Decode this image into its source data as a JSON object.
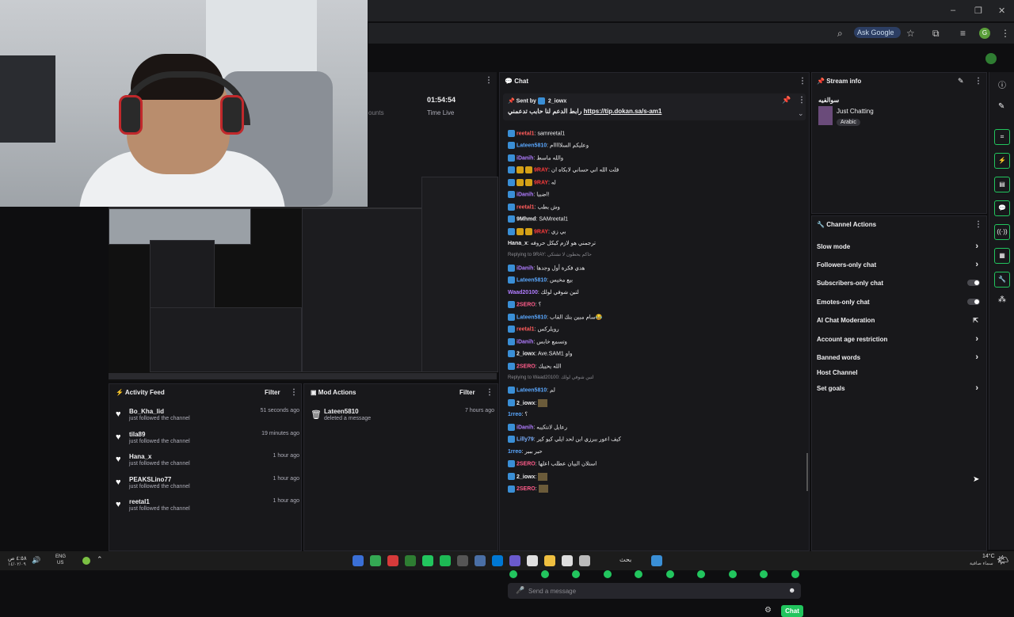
{
  "browser": {
    "ask_google": "Ask Google",
    "window_controls": [
      "–",
      "❐",
      "✕"
    ],
    "avatar_letter": "G"
  },
  "preview": {
    "time_value": "01:54:54",
    "time_label": "Time Live",
    "faded_label": "ounts"
  },
  "activity_feed": {
    "title": "Activity Feed",
    "filter": "Filter",
    "items": [
      {
        "name": "Bo_Kha_lid",
        "sub": "just followed the channel",
        "time": "51 seconds ago"
      },
      {
        "name": "tila89",
        "sub": "just followed the channel",
        "time": "19 minutes ago"
      },
      {
        "name": "Hana_x",
        "sub": "just followed the channel",
        "time": "1 hour ago"
      },
      {
        "name": "PEAKSLino77",
        "sub": "just followed the channel",
        "time": "1 hour ago"
      },
      {
        "name": "reetal1",
        "sub": "just followed the channel",
        "time": "1 hour ago"
      }
    ]
  },
  "mod_actions": {
    "title": "Mod Actions",
    "filter": "Filter",
    "items": [
      {
        "name": "Lateen5810",
        "sub": "deleted a message",
        "time": "7 hours ago"
      }
    ]
  },
  "chat": {
    "title": "Chat",
    "pinned_sender_prefix": "Sent by",
    "pinned_sender": "2_iowx",
    "pinned_text": "رابط الدعم لنا حابب تدعمني",
    "pinned_link": "https://tip.dokan.sa/s-am1",
    "messages": [
      {
        "user": "reetal1",
        "color": "#ff5c5c",
        "text": "samreetal1",
        "badges": 1
      },
      {
        "user": "Lateen5810",
        "color": "#5aa8ff",
        "text": "وعليكم السلااااام",
        "badges": 1
      },
      {
        "user": "iDanih",
        "color": "#b07cff",
        "text": "والله ماسط",
        "badges": 1
      },
      {
        "user": "9RAY",
        "color": "#ff3c3c",
        "text": "قلت الله اني حساني لابكاه ان",
        "badges": 3
      },
      {
        "user": "9RAY",
        "color": "#ff3c3c",
        "text": "له",
        "badges": 3
      },
      {
        "user": "iDanih",
        "color": "#b07cff",
        "text": "اضبيا!",
        "badges": 1
      },
      {
        "user": "reetal1",
        "color": "#ff5c5c",
        "text": "وش بطب",
        "badges": 1
      },
      {
        "user": "9Mhmd",
        "color": "#efeff1",
        "text": "SAMreetal1",
        "badges": 1
      },
      {
        "user": "9RAY",
        "color": "#ff3c3c",
        "text": "بي زي",
        "badges": 3
      },
      {
        "user": "Hana_x",
        "color": "#efeff1",
        "text": "ترجمني هو لازم كيكل حروفه",
        "badges": 0
      },
      {
        "user": "",
        "color": "#8a8a90",
        "text": "Replying to 9RAY: حاكم يحطون لا تشتكي",
        "badges": 0,
        "reply": true
      },
      {
        "user": "iDanih",
        "color": "#b07cff",
        "text": "هدي فكرة أول وجدها",
        "badges": 1
      },
      {
        "user": "Lateen5810",
        "color": "#5aa8ff",
        "text": "بيع مخيس",
        "badges": 1
      },
      {
        "user": "Waad20100",
        "color": "#b07cff",
        "text": "لتين شوفي لولك",
        "badges": 0
      },
      {
        "user": "2SERO",
        "color": "#ff5c8a",
        "text": "؟",
        "badges": 1
      },
      {
        "user": "Lateen5810",
        "color": "#5aa8ff",
        "text": "سام مبين بنك القاب😂",
        "badges": 1
      },
      {
        "user": "reetal1",
        "color": "#ff5c5c",
        "text": "رويلركس",
        "badges": 1
      },
      {
        "user": "iDanih",
        "color": "#b07cff",
        "text": "وتسمع خابس",
        "badges": 1
      },
      {
        "user": "2_iowx",
        "color": "#efeff1",
        "text": "Ave.SAM1 واو",
        "badges": 1
      },
      {
        "user": "2SERO",
        "color": "#ff5c8a",
        "text": "الله يحييك",
        "badges": 1
      },
      {
        "user": "",
        "color": "#8a8a90",
        "text": "Replying to Waad20100: لتين شوفي لولك",
        "badges": 0,
        "reply": true
      },
      {
        "user": "Lateen5810",
        "color": "#5aa8ff",
        "text": "لم",
        "badges": 1
      },
      {
        "user": "2_iowx",
        "color": "#efeff1",
        "text": "",
        "badges": 1,
        "emote": true
      },
      {
        "user": "1rreo",
        "color": "#5aa8ff",
        "text": "؟",
        "badges": 0
      },
      {
        "user": "iDanih",
        "color": "#b07cff",
        "text": "رعايل لانتكيبه",
        "badges": 1
      },
      {
        "user": "Lilly79",
        "color": "#7ab0ff",
        "text": "كيف اعور ببرزي ابن لحد ايلي كيو كير",
        "badges": 1
      },
      {
        "user": "1rreo",
        "color": "#5aa8ff",
        "text": "حير ببير",
        "badges": 0
      },
      {
        "user": "2SERO",
        "color": "#ff5c8a",
        "text": "استلان البيان عطلب اعلها",
        "badges": 1
      },
      {
        "user": "2_iowx",
        "color": "#efeff1",
        "text": "",
        "badges": 1,
        "emote": true
      },
      {
        "user": "2SERO",
        "color": "#ff5c8a",
        "text": "",
        "badges": 1,
        "emote": true
      }
    ],
    "input_placeholder": "Send a message",
    "send_label": "Chat"
  },
  "stream_info": {
    "title": "Stream info",
    "stream_title": "سوالفيه",
    "category": "Just Chatting",
    "tag": "Arabic"
  },
  "channel_actions": {
    "title": "Channel Actions",
    "items": [
      {
        "label": "Slow mode",
        "control": "chevron"
      },
      {
        "label": "Followers-only chat",
        "control": "chevron"
      },
      {
        "label": "Subscribers-only chat",
        "control": "toggle"
      },
      {
        "label": "Emotes-only chat",
        "control": "toggle"
      },
      {
        "label": "AI Chat Moderation",
        "control": "external"
      },
      {
        "label": "Account age restriction",
        "control": "chevron"
      },
      {
        "label": "Banned words",
        "control": "chevron"
      },
      {
        "label": "Host Channel",
        "control": "none"
      },
      {
        "label": "Set goals",
        "control": "chevron"
      }
    ]
  },
  "taskbar": {
    "lang_top": "ENG",
    "lang_bottom": "US",
    "clock_time": "٤:٥٨ ص",
    "clock_date": "١٤/٠٢/٠٩",
    "weather_temp": "14°C",
    "weather_desc": "سماء صافية",
    "search_text": "بحث"
  },
  "colors": {
    "accent": "#22c55e",
    "panel_bg": "#18181b",
    "page_bg": "#0e0e10"
  }
}
